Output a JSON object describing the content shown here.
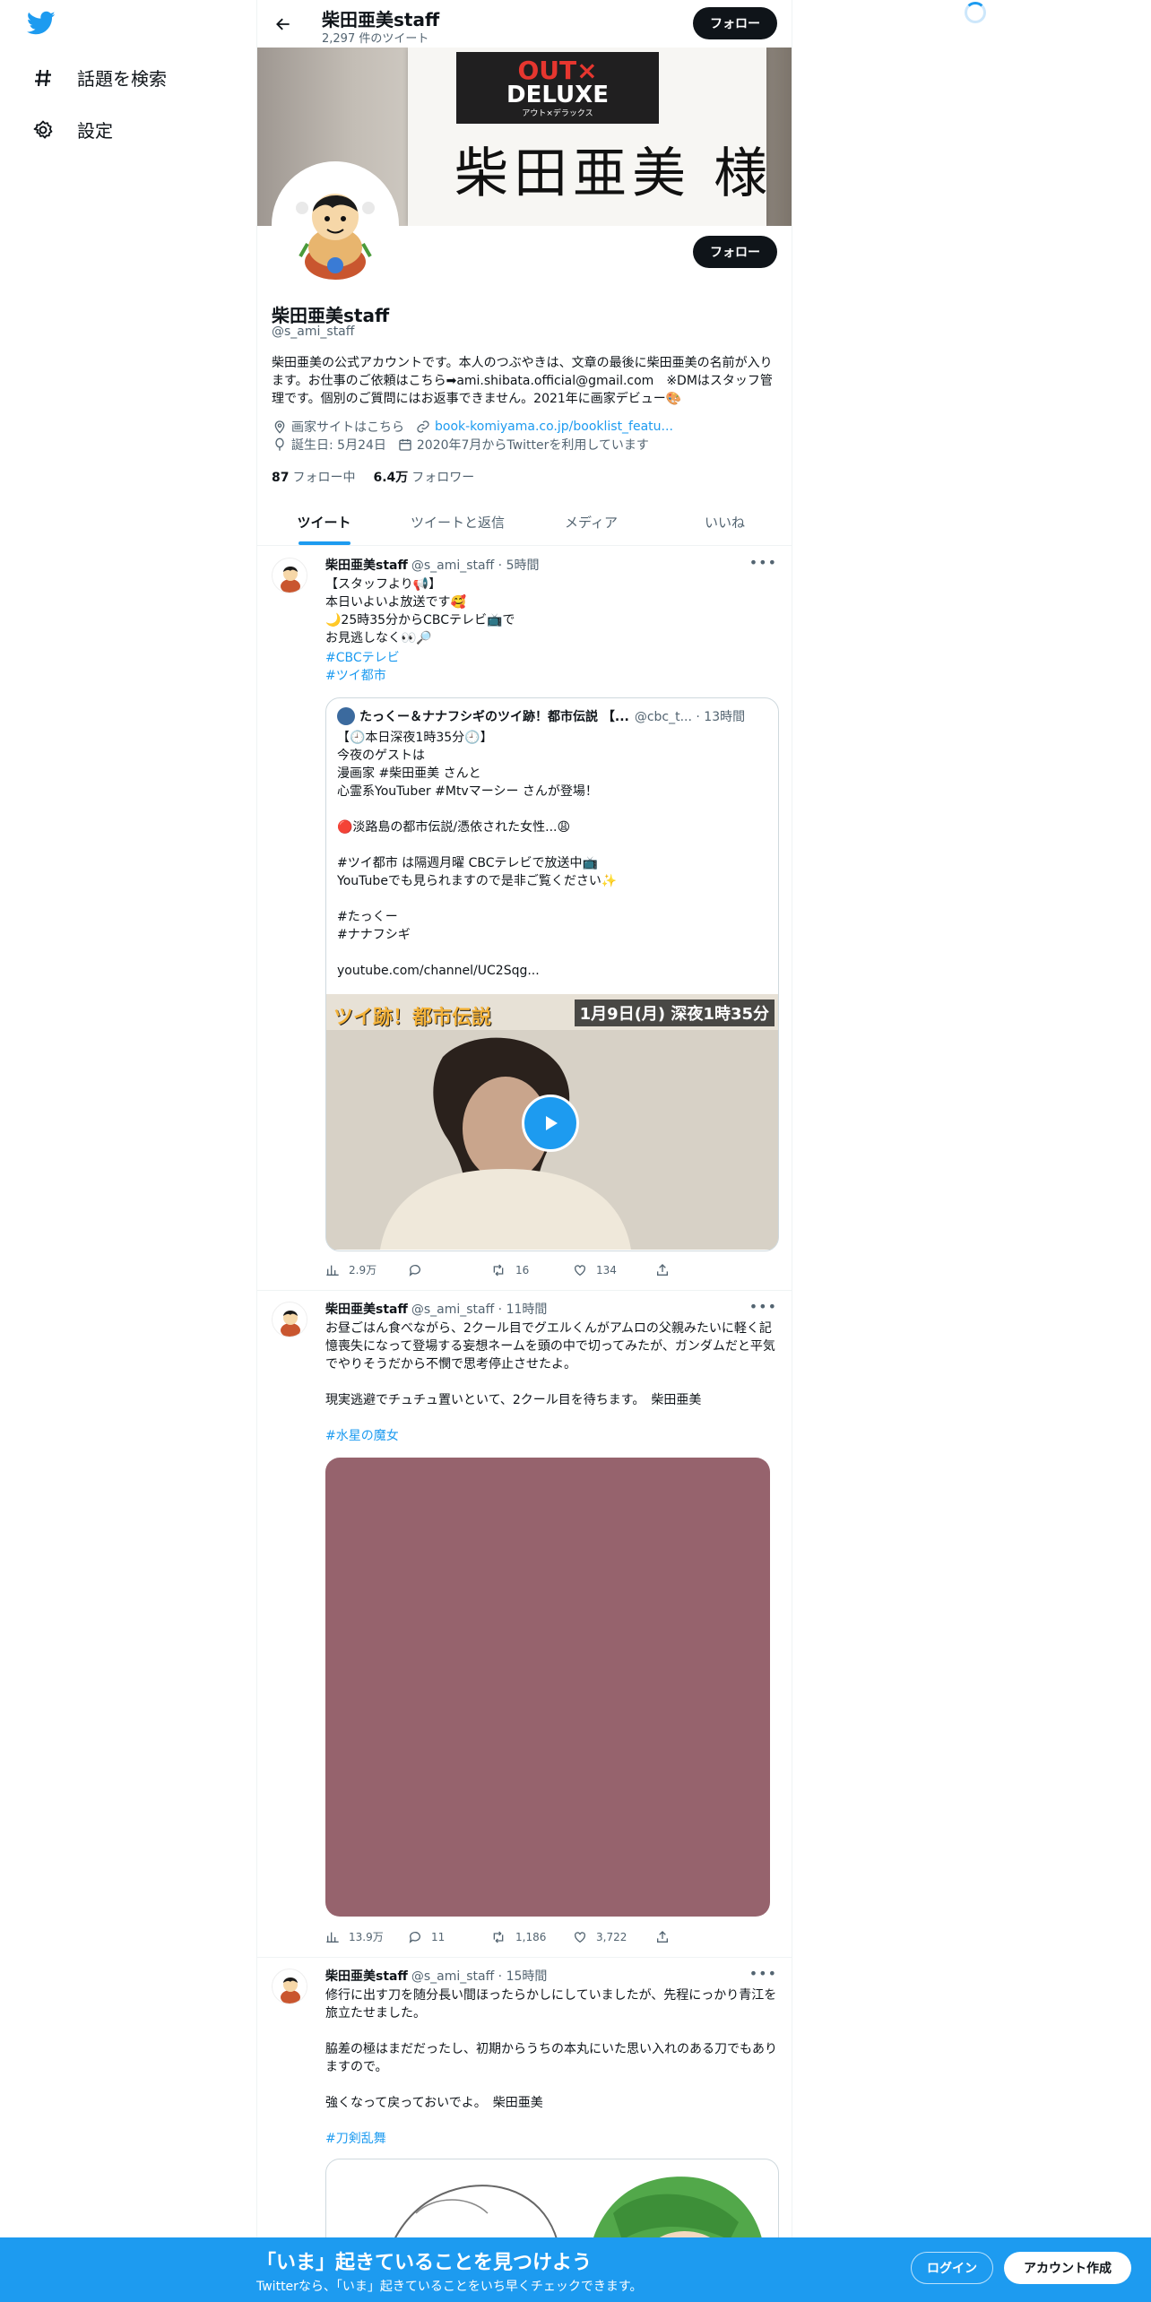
{
  "colors": {
    "accent": "#1d9bf0",
    "dark": "#0f1419",
    "muted": "#536471",
    "media_placeholder": "#96636d"
  },
  "sidebar": {
    "items": [
      {
        "label": "話題を検索",
        "icon": "hashtag-icon"
      },
      {
        "label": "設定",
        "icon": "gear-icon"
      }
    ]
  },
  "header": {
    "name": "柴田亜美staff",
    "tweet_count": "2,297 件のツイート",
    "follow": "フォロー"
  },
  "banner": {
    "logo_top": "OUT×",
    "logo_bottom": "DELUXE",
    "logo_small": "アウト×デラックス",
    "sign_text": "柴田亜美 様"
  },
  "profile": {
    "name": "柴田亜美staff",
    "handle": "@s_ami_staff",
    "bio": "柴田亜美の公式アカウントです。本人のつぶやきは、文章の最後に柴田亜美の名前が入ります。お仕事のご依頼はこちら➡ami.shibata.official@gmail.com　※DMはスタッフ管理です。個別のご質問にはお返事できません。2021年に画家デビュー🎨",
    "location": "画家サイトはこちら",
    "website": "book-komiyama.co.jp/booklist_featu...",
    "birthday": "誕生日: 5月24日",
    "joined": "2020年7月からTwitterを利用しています",
    "following_count": "87",
    "following_label": "フォロー中",
    "followers_count": "6.4万",
    "followers_label": "フォロワー",
    "follow": "フォロー"
  },
  "tabs": [
    {
      "label": "ツイート",
      "active": true
    },
    {
      "label": "ツイートと返信",
      "active": false
    },
    {
      "label": "メディア",
      "active": false
    },
    {
      "label": "いいね",
      "active": false
    }
  ],
  "tweets": [
    {
      "name": "柴田亜美staff",
      "handle": "@s_ami_staff · 5時間",
      "text": "【スタッフより📢】\n本日いよいよ放送です🥰\n🌙25時35分からCBCテレビ📺で\nお見逃しなく👀🔎",
      "hashtags": [
        "#CBCテレビ",
        "#ツイ都市"
      ],
      "quote": {
        "name": "たっくー＆ナナフシギのツイ跡！都市伝説 【...",
        "handle": "@cbc_t... · 13時間",
        "text": "【🕘本日深夜1時35分🕘】\n今夜のゲストは\n漫画家 #柴田亜美 さんと\n心霊系YouTuber #Mtvマーシー さんが登場！\n\n🔴淡路島の都市伝説/憑依された女性...😩\n\n#ツイ都市 は隔週月曜 CBCテレビで放送中📺\nYouTubeでも見られますので是非ご覧ください✨\n\n#たっくー\n#ナナフシギ\n\nyoutube.com/channel/UC2Sqg...",
        "media_title": "ツイ跡！都市伝説",
        "media_date": "1月9日(月) 深夜1時35分"
      },
      "views": "2.9万",
      "replies": "",
      "retweets": "16",
      "likes": "134"
    },
    {
      "name": "柴田亜美staff",
      "handle": "@s_ami_staff · 11時間",
      "text": "お昼ごはん食べながら、2クール目でグエルくんがアムロの父親みたいに軽く記憶喪失になって登場する妄想ネームを頭の中で切ってみたが、ガンダムだと平気でやりそうだから不憫で思考停止させたよ。\n\n現実逃避でチュチュ置いといて、2クール目を待ちます。　柴田亜美",
      "hashtags": [
        "#水星の魔女"
      ],
      "views": "13.9万",
      "replies": "11",
      "retweets": "1,186",
      "likes": "3,722"
    },
    {
      "name": "柴田亜美staff",
      "handle": "@s_ami_staff · 15時間",
      "text": "修行に出す刀を随分長い間ほったらかしにしていましたが、先程にっかり青江を旅立たせました。\n\n脇差の極はまだだったし、初期からうちの本丸にいた思い入れのある刀でもありますので。\n\n強くなって戻っておいでよ。　柴田亜美",
      "hashtags": [
        "#刀剣乱舞"
      ]
    }
  ],
  "bottom_bar": {
    "title": "「いま」起きていることを見つけよう",
    "subtitle": "Twitterなら、「いま」起きていることをいち早くチェックできます。",
    "login": "ログイン",
    "signup": "アカウント作成"
  }
}
